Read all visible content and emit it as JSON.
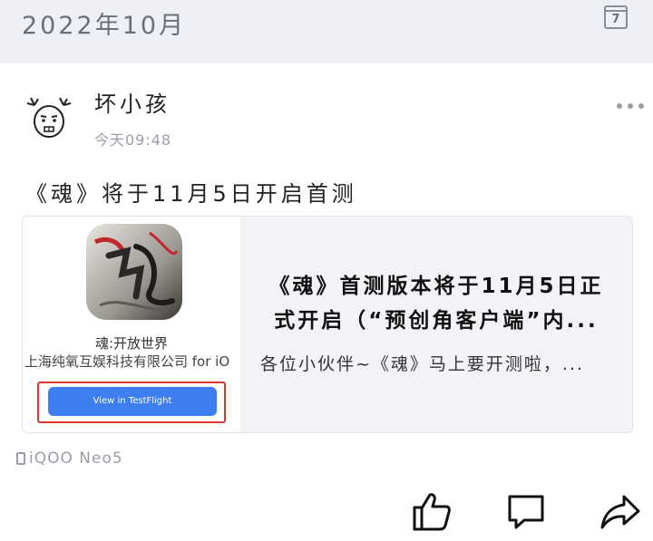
{
  "header": {
    "month": "2022年10月",
    "calendar_day": "7"
  },
  "post": {
    "username": "坏小孩",
    "time": "今天09:48",
    "text": "《魂》将于11月5日开启首测"
  },
  "card": {
    "app_name": "魂:开放世界",
    "developer": "上海纯氧互娱科技有限公司 for iO",
    "testflight_button": "View in TestFlight",
    "title": "《魂》首测版本将于11月5日正式开启（“预创角客户端”内...",
    "description": "各位小伙伴~《魂》马上要开测啦，..."
  },
  "device": "iQOO Neo5",
  "icons": {
    "calendar": "calendar-icon",
    "more": "more-icon",
    "like": "thumbs-up-icon",
    "comment": "comment-icon",
    "share": "share-icon"
  },
  "colors": {
    "accent": "#3d7ef0",
    "highlight": "#d43a2f",
    "header_bg": "#eef0f5"
  }
}
